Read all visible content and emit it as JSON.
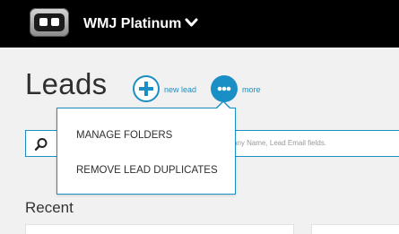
{
  "header": {
    "account_name": "WMJ Platinum",
    "logo_icon": "robot-logo-icon",
    "account_menu_icon": "chevron-down-icon"
  },
  "page": {
    "title": "Leads"
  },
  "actions": {
    "new_lead_label": "new lead",
    "new_lead_icon": "plus-icon",
    "more_label": "more",
    "more_icon": "ellipsis-icon"
  },
  "more_menu": {
    "items": [
      {
        "label": "MANAGE FOLDERS"
      },
      {
        "label": "REMOVE LEAD DUPLICATES"
      }
    ]
  },
  "search": {
    "placeholder_visible": "any Name, Lead Email fields.",
    "icon": "search-icon"
  },
  "recent": {
    "heading": "Recent"
  },
  "colors": {
    "accent": "#1a8fc6",
    "topbar": "#000000",
    "background": "#f1f1f1"
  }
}
